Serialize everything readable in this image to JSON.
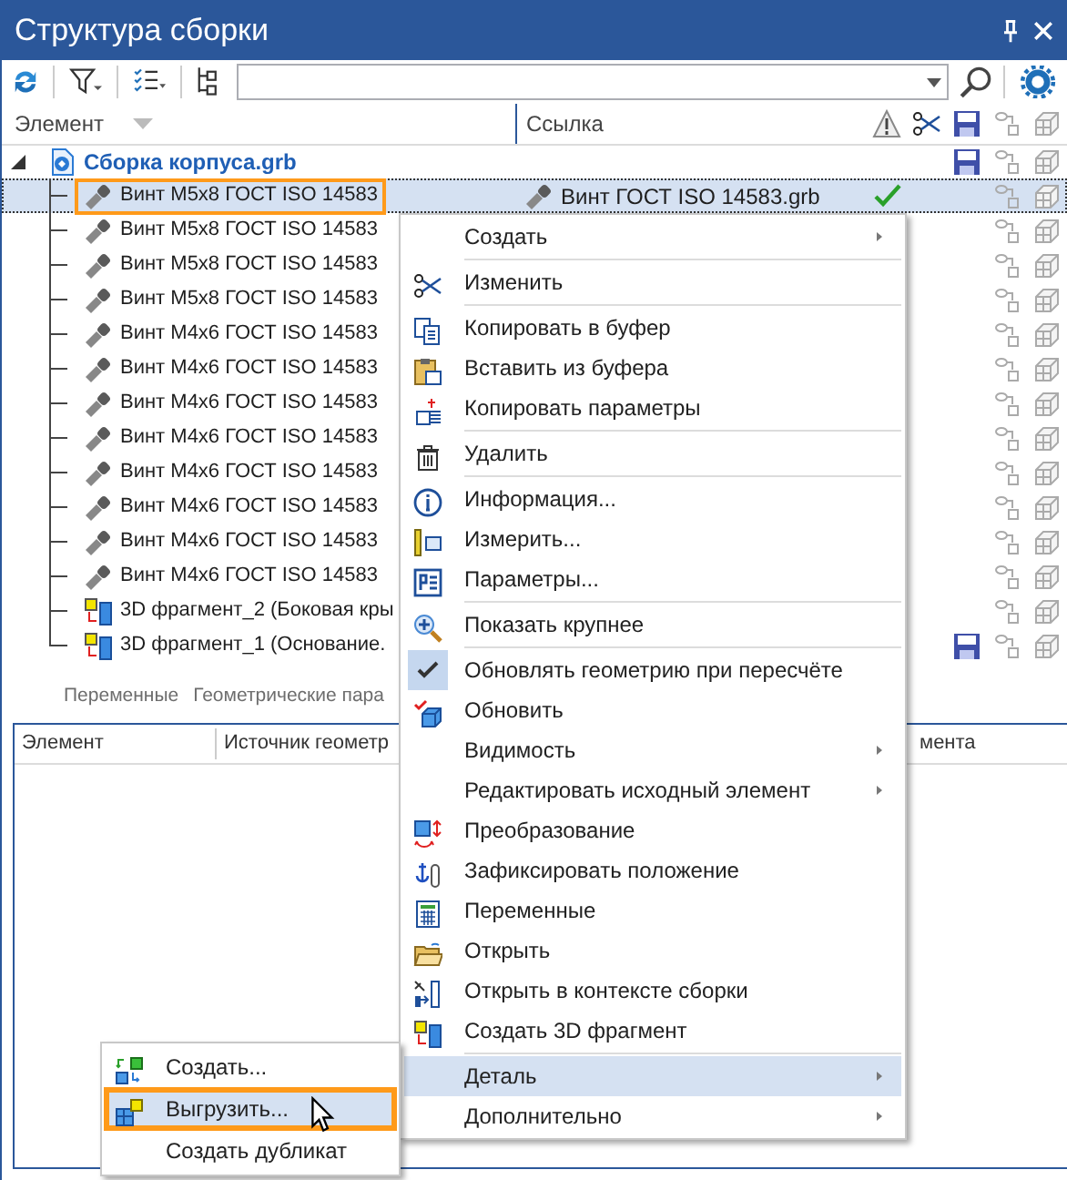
{
  "window": {
    "title": "Структура сборки"
  },
  "columns": {
    "element": "Элемент",
    "link": "Ссылка"
  },
  "tree": {
    "name": "Сборка корпуса.grb",
    "expanded": true,
    "saved": true,
    "children": [
      {
        "name": "Винт M5x8 ГОСТ ISO 14583",
        "kind": "screw",
        "selected": true,
        "highlighted": true,
        "link": "Винт ГОСТ ISO 14583.grb",
        "link_ok": true,
        "saved": false
      },
      {
        "name": "Винт M5x8 ГОСТ ISO 14583",
        "kind": "screw",
        "selected": false,
        "highlighted": false,
        "saved": false
      },
      {
        "name": "Винт M5x8 ГОСТ ISO 14583",
        "kind": "screw",
        "selected": false,
        "highlighted": false,
        "saved": false
      },
      {
        "name": "Винт M5x8 ГОСТ ISO 14583",
        "kind": "screw",
        "selected": false,
        "highlighted": false,
        "saved": false
      },
      {
        "name": "Винт M4x6 ГОСТ ISO 14583",
        "kind": "screw",
        "selected": false,
        "highlighted": false,
        "saved": false
      },
      {
        "name": "Винт M4x6 ГОСТ ISO 14583",
        "kind": "screw",
        "selected": false,
        "highlighted": false,
        "saved": false
      },
      {
        "name": "Винт M4x6 ГОСТ ISO 14583",
        "kind": "screw",
        "selected": false,
        "highlighted": false,
        "saved": false
      },
      {
        "name": "Винт M4x6 ГОСТ ISO 14583",
        "kind": "screw",
        "selected": false,
        "highlighted": false,
        "saved": false
      },
      {
        "name": "Винт M4x6 ГОСТ ISO 14583",
        "kind": "screw",
        "selected": false,
        "highlighted": false,
        "saved": false
      },
      {
        "name": "Винт M4x6 ГОСТ ISO 14583",
        "kind": "screw",
        "selected": false,
        "highlighted": false,
        "saved": false
      },
      {
        "name": "Винт M4x6 ГОСТ ISO 14583",
        "kind": "screw",
        "selected": false,
        "highlighted": false,
        "saved": false
      },
      {
        "name": "Винт M4x6 ГОСТ ISO 14583",
        "kind": "screw",
        "selected": false,
        "highlighted": false,
        "saved": false
      },
      {
        "name": "3D фрагмент_2 (Боковая кры",
        "kind": "fragment",
        "selected": false,
        "highlighted": false,
        "saved": false
      },
      {
        "name": "3D фрагмент_1 (Основание.",
        "kind": "fragment",
        "selected": false,
        "highlighted": false,
        "saved": true
      }
    ]
  },
  "bottom_tabs": [
    "Переменные",
    "Геометрические пара"
  ],
  "bottom_table": {
    "columns": [
      "Элемент",
      "Источник геометр",
      "мента"
    ]
  },
  "context_menu": [
    {
      "kind": "item",
      "label": "Создать",
      "submenu": true,
      "checked": false,
      "highlighted": false
    },
    {
      "kind": "separator"
    },
    {
      "kind": "item",
      "label": "Изменить",
      "submenu": false,
      "checked": false,
      "highlighted": false
    },
    {
      "kind": "separator"
    },
    {
      "kind": "item",
      "label": "Копировать в буфер",
      "submenu": false,
      "checked": false,
      "highlighted": false
    },
    {
      "kind": "item",
      "label": "Вставить из буфера",
      "submenu": false,
      "checked": false,
      "highlighted": false
    },
    {
      "kind": "item",
      "label": "Копировать параметры",
      "submenu": false,
      "checked": false,
      "highlighted": false
    },
    {
      "kind": "separator"
    },
    {
      "kind": "item",
      "label": "Удалить",
      "submenu": false,
      "checked": false,
      "highlighted": false
    },
    {
      "kind": "separator"
    },
    {
      "kind": "item",
      "label": "Информация...",
      "submenu": false,
      "checked": false,
      "highlighted": false
    },
    {
      "kind": "item",
      "label": "Измерить...",
      "submenu": false,
      "checked": false,
      "highlighted": false
    },
    {
      "kind": "item",
      "label": "Параметры...",
      "submenu": false,
      "checked": false,
      "highlighted": false
    },
    {
      "kind": "separator"
    },
    {
      "kind": "item",
      "label": "Показать крупнее",
      "submenu": false,
      "checked": false,
      "highlighted": false
    },
    {
      "kind": "separator"
    },
    {
      "kind": "item",
      "label": "Обновлять геометрию при пересчёте",
      "submenu": false,
      "checked": true,
      "highlighted": false
    },
    {
      "kind": "item",
      "label": "Обновить",
      "submenu": false,
      "checked": false,
      "highlighted": false
    },
    {
      "kind": "item",
      "label": "Видимость",
      "submenu": true,
      "checked": false,
      "highlighted": false
    },
    {
      "kind": "item",
      "label": "Редактировать исходный элемент",
      "submenu": true,
      "checked": false,
      "highlighted": false
    },
    {
      "kind": "item",
      "label": "Преобразование",
      "submenu": false,
      "checked": false,
      "highlighted": false
    },
    {
      "kind": "item",
      "label": "Зафиксировать положение",
      "submenu": false,
      "checked": false,
      "highlighted": false
    },
    {
      "kind": "item",
      "label": "Переменные",
      "submenu": false,
      "checked": false,
      "highlighted": false
    },
    {
      "kind": "item",
      "label": "Открыть",
      "submenu": false,
      "checked": false,
      "highlighted": false
    },
    {
      "kind": "item",
      "label": "Открыть в контексте сборки",
      "submenu": false,
      "checked": false,
      "highlighted": false
    },
    {
      "kind": "item",
      "label": "Создать 3D фрагмент",
      "submenu": false,
      "checked": false,
      "highlighted": false
    },
    {
      "kind": "separator"
    },
    {
      "kind": "item",
      "label": "Деталь",
      "submenu": true,
      "checked": false,
      "highlighted": true
    },
    {
      "kind": "item",
      "label": "Дополнительно",
      "submenu": true,
      "checked": false,
      "highlighted": false
    }
  ],
  "submenu": [
    {
      "label": "Создать...",
      "highlighted": false
    },
    {
      "label": "Выгрузить...",
      "highlighted": true
    },
    {
      "label": "Создать дубликат",
      "highlighted": false
    }
  ]
}
